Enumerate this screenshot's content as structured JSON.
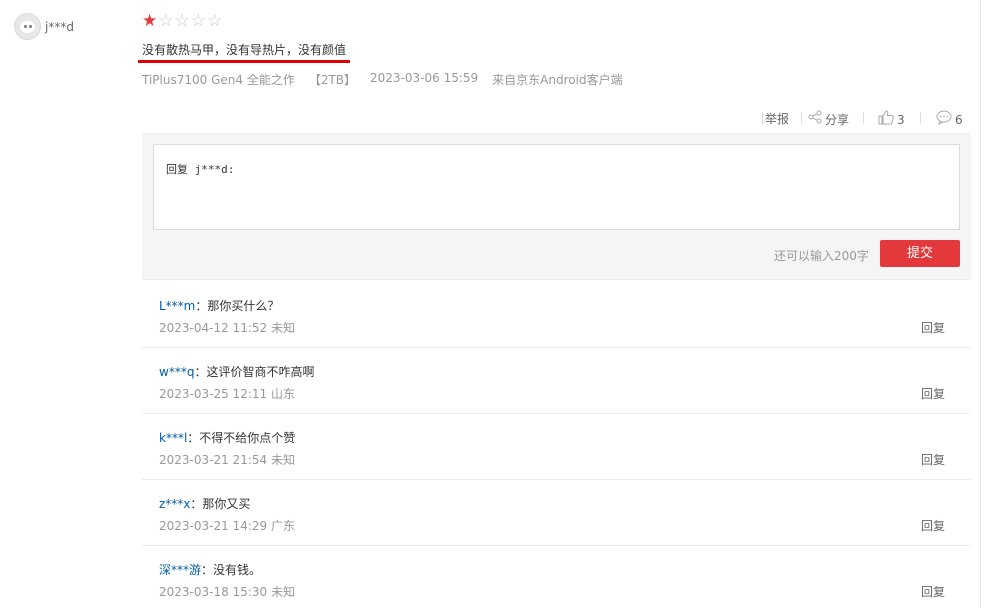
{
  "user": {
    "name": "j***d"
  },
  "review": {
    "rating": 1,
    "rating_max": 5,
    "text": "没有散热马甲，没有导热片，没有颜值",
    "product": "TiPlus7100 Gen4 全能之作",
    "spec": "【2TB】",
    "date": "2023-03-06 15:59",
    "source": "来自京东Android客户端"
  },
  "actions": {
    "report_label": "举报",
    "share_label": "分享",
    "like_count": "3",
    "comment_count": "6"
  },
  "reply_form": {
    "placeholder": "回复 j***d:",
    "remaining": "还可以输入200字",
    "submit_label": "提交"
  },
  "replies": [
    {
      "name": "L***m",
      "text": "：那你买什么？",
      "date": "2023-04-12 11:52",
      "location": "未知",
      "reply_label": "回复"
    },
    {
      "name": "w***q",
      "text": "：这评价智商不咋高啊",
      "date": "2023-03-25 12:11",
      "location": "山东",
      "reply_label": "回复"
    },
    {
      "name": "k***l",
      "text": "：不得不给你点个赞",
      "date": "2023-03-21 21:54",
      "location": "未知",
      "reply_label": "回复"
    },
    {
      "name": "z***x",
      "text": "：那你又买",
      "date": "2023-03-21 14:29",
      "location": "广东",
      "reply_label": "回复"
    },
    {
      "name": "深***游",
      "text": "：没有钱。",
      "date": "2023-03-18 15:30",
      "location": "未知",
      "reply_label": "回复"
    }
  ],
  "colors": {
    "accent": "#e4393c",
    "link": "#005ea7",
    "annotation_underline": "#e00000"
  },
  "icons": {
    "share": "share-icon",
    "like": "thumbs-up-icon",
    "comment": "comment-bubble-icon",
    "star": "star-icon"
  }
}
